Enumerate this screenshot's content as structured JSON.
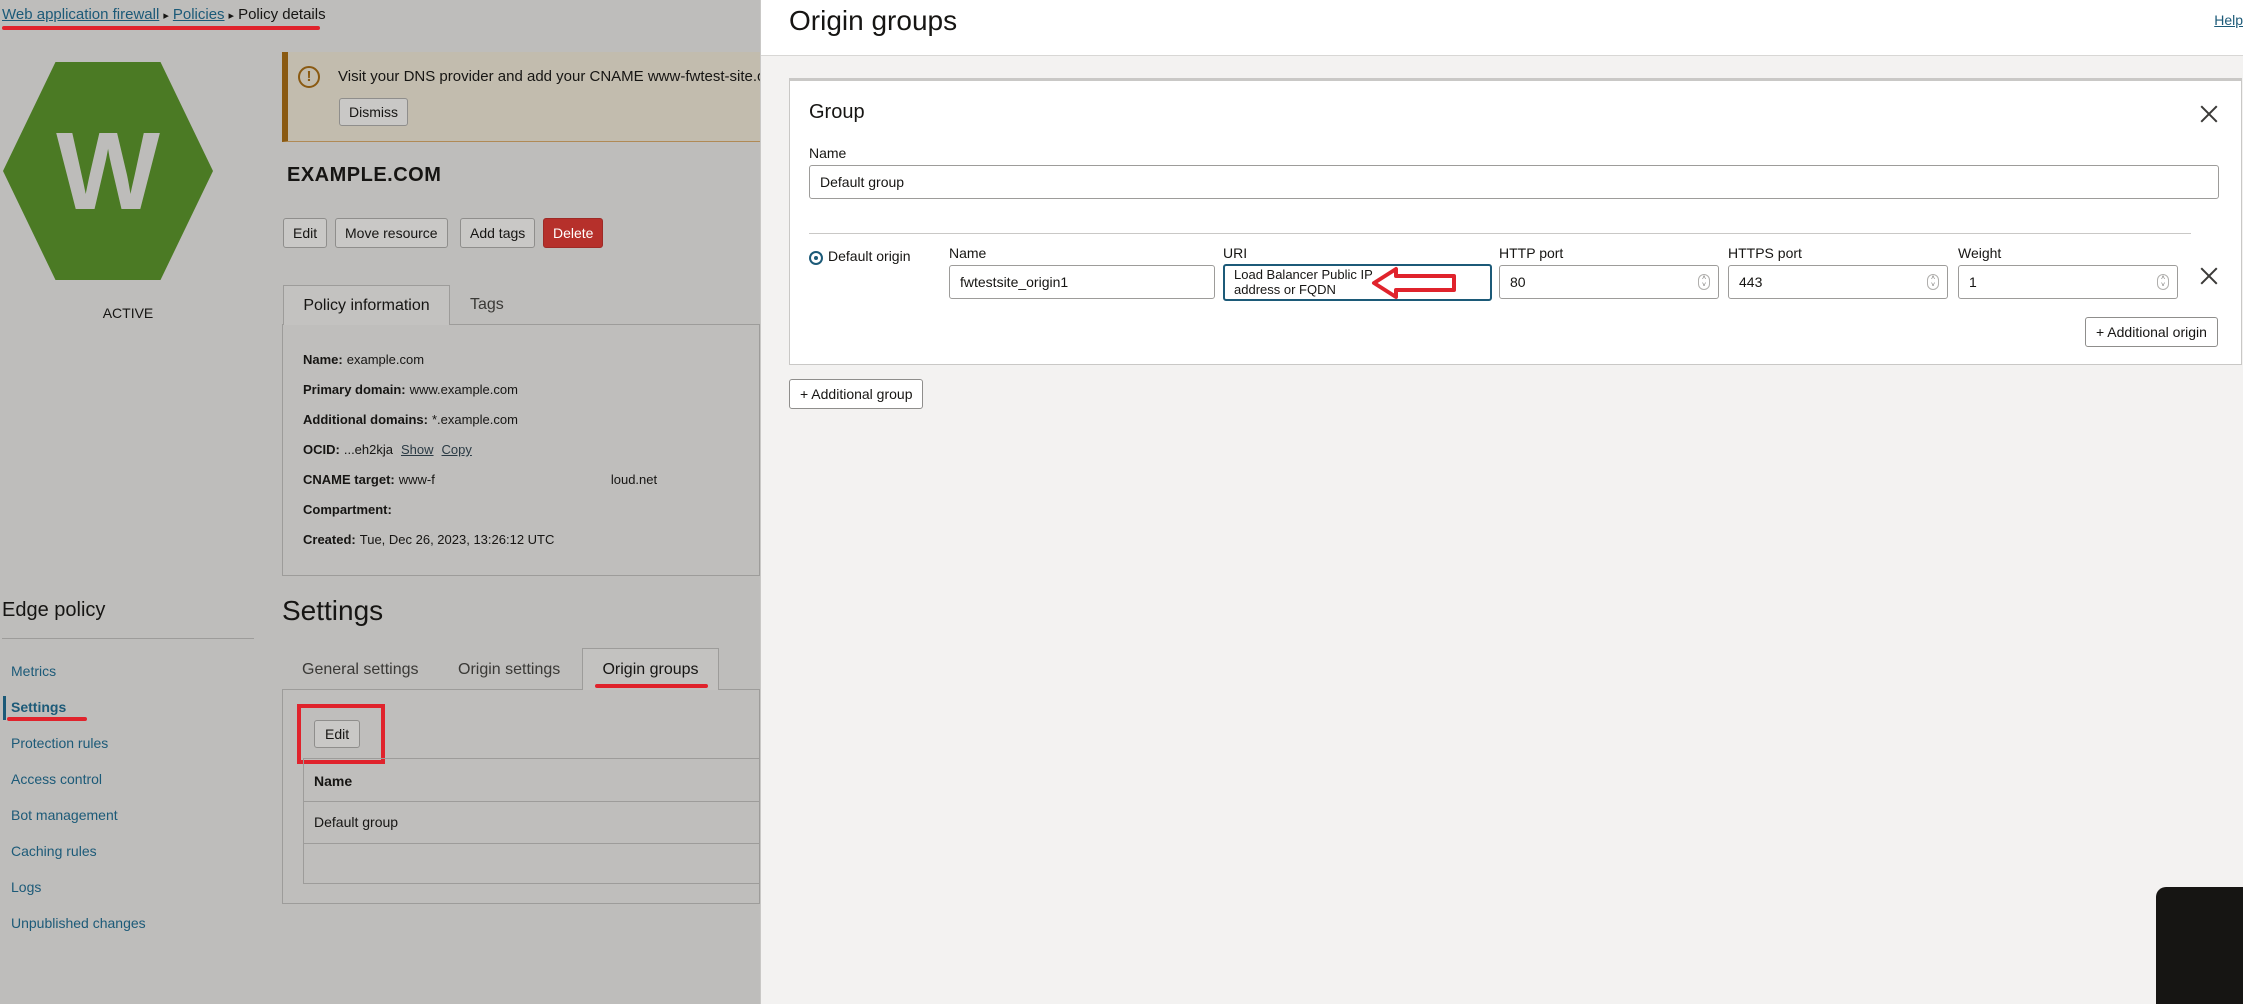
{
  "breadcrumb": {
    "item1": "Web application firewall",
    "item2": "Policies",
    "item3": "Policy details",
    "sep": "▸"
  },
  "policy": {
    "logo_letter": "W",
    "status": "ACTIVE",
    "banner_text": "Visit your DNS provider and add your CNAME www-fwtest-site.o.waa",
    "banner_dismiss": "Dismiss",
    "title": "EXAMPLE.COM",
    "buttons": {
      "edit": "Edit",
      "move": "Move resource",
      "tags": "Add tags",
      "delete": "Delete"
    },
    "tabs": {
      "info": "Policy information",
      "tags": "Tags"
    },
    "info": {
      "name_label": "Name:",
      "name_value": "example.com",
      "primary_label": "Primary domain:",
      "primary_value": "www.example.com",
      "additional_label": "Additional domains:",
      "additional_value": "*.example.com",
      "ocid_label": "OCID:",
      "ocid_value": "...eh2kja",
      "ocid_show": "Show",
      "ocid_copy": "Copy",
      "cname_label": "CNAME target:",
      "cname_value_a": "www-f",
      "cname_value_b": "loud.net",
      "compartment_label": "Compartment:",
      "created_label": "Created:",
      "created_value": "Tue, Dec 26, 2023, 13:26:12 UTC"
    }
  },
  "edge": {
    "title": "Edge policy",
    "nav": [
      "Metrics",
      "Settings",
      "Protection rules",
      "Access control",
      "Bot management",
      "Caching rules",
      "Logs",
      "Unpublished changes"
    ]
  },
  "settings": {
    "title": "Settings",
    "tabs": {
      "general": "General settings",
      "origin": "Origin settings",
      "groups": "Origin groups"
    },
    "edit": "Edit",
    "table_header": "Name",
    "table_row": "Default group"
  },
  "drawer": {
    "title": "Origin groups",
    "help": "Help",
    "group": {
      "title": "Group",
      "name_label": "Name",
      "name_value": "Default group",
      "default_origin_label": "Default origin",
      "col_name": "Name",
      "col_uri": "URI",
      "col_http": "HTTP port",
      "col_https": "HTTPS port",
      "col_weight": "Weight",
      "origin_name": "fwtestsite_origin1",
      "uri_line1": "Load Balancer Public IP",
      "uri_line2": "address or FQDN",
      "http_port": "80",
      "https_port": "443",
      "weight": "1",
      "add_origin": "+ Additional origin"
    },
    "add_group": "+ Additional group"
  },
  "colors": {
    "accent": "#1c5a78",
    "danger": "#b6302b",
    "highlight": "#e0232c",
    "logo": "#4b7a24"
  }
}
